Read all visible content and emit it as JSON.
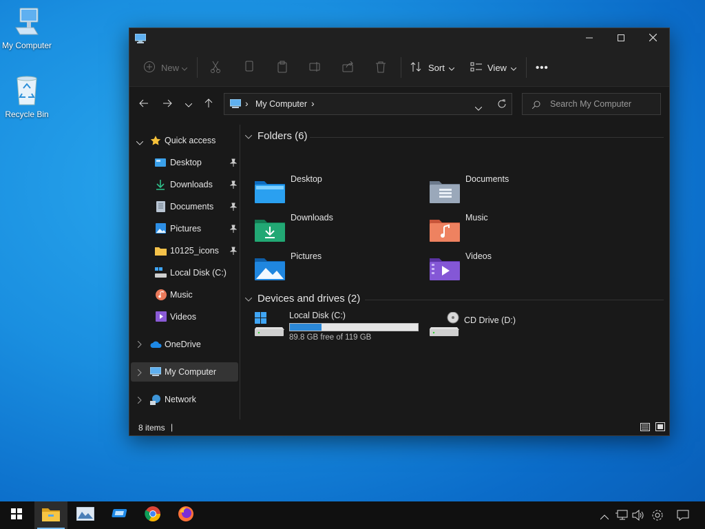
{
  "desktop": {
    "icons": [
      {
        "label": "My Computer",
        "icon": "computer-icon"
      },
      {
        "label": "Recycle Bin",
        "icon": "recycle-bin-icon"
      }
    ]
  },
  "window": {
    "controls": {
      "minimize": "minimize-icon",
      "maximize": "maximize-icon",
      "close": "close-icon"
    },
    "toolbar": {
      "new_label": "New",
      "sort_label": "Sort",
      "view_label": "View",
      "more_label": "•••"
    },
    "address": {
      "separator": "›",
      "location": "My Computer"
    },
    "search": {
      "placeholder": "Search My Computer"
    },
    "sidebar": {
      "quick_access": "Quick access",
      "items": [
        {
          "label": "Desktop",
          "pinned": true
        },
        {
          "label": "Downloads",
          "pinned": true
        },
        {
          "label": "Documents",
          "pinned": true
        },
        {
          "label": "Pictures",
          "pinned": true
        },
        {
          "label": "10125_icons",
          "pinned": true
        },
        {
          "label": "Local Disk (C:)",
          "pinned": false
        },
        {
          "label": "Music",
          "pinned": false
        },
        {
          "label": "Videos",
          "pinned": false
        }
      ],
      "onedrive": "OneDrive",
      "my_computer": "My Computer",
      "network": "Network"
    },
    "content": {
      "folders_header": "Folders (6)",
      "folders": [
        {
          "label": "Desktop",
          "color": "#1e90e8"
        },
        {
          "label": "Documents",
          "color": "#8a9bb0"
        },
        {
          "label": "Downloads",
          "color": "#1f9b6a"
        },
        {
          "label": "Music",
          "color": "#e8714a"
        },
        {
          "label": "Pictures",
          "color": "#1b7fd6"
        },
        {
          "label": "Videos",
          "color": "#7d4fc9"
        }
      ],
      "devices_header": "Devices and drives (2)",
      "drives": [
        {
          "label": "Local Disk (C:)",
          "free_text": "89.8 GB free of 119 GB",
          "used_fraction": 0.245
        },
        {
          "label": "CD Drive (D:)"
        }
      ]
    },
    "status": {
      "items_text": "8 items",
      "cursor": "|"
    }
  },
  "taskbar": {
    "apps": [
      "start-icon",
      "file-explorer-icon",
      "image-viewer-icon",
      "app-icon",
      "chrome-icon",
      "firefox-icon"
    ],
    "tray": [
      "chevron-up-icon",
      "network-icon",
      "volume-icon",
      "settings-icon",
      "notifications-icon"
    ]
  },
  "colors": {
    "accent": "#76b9ed",
    "progress": "#2b88d8",
    "window_bg": "#191919"
  }
}
